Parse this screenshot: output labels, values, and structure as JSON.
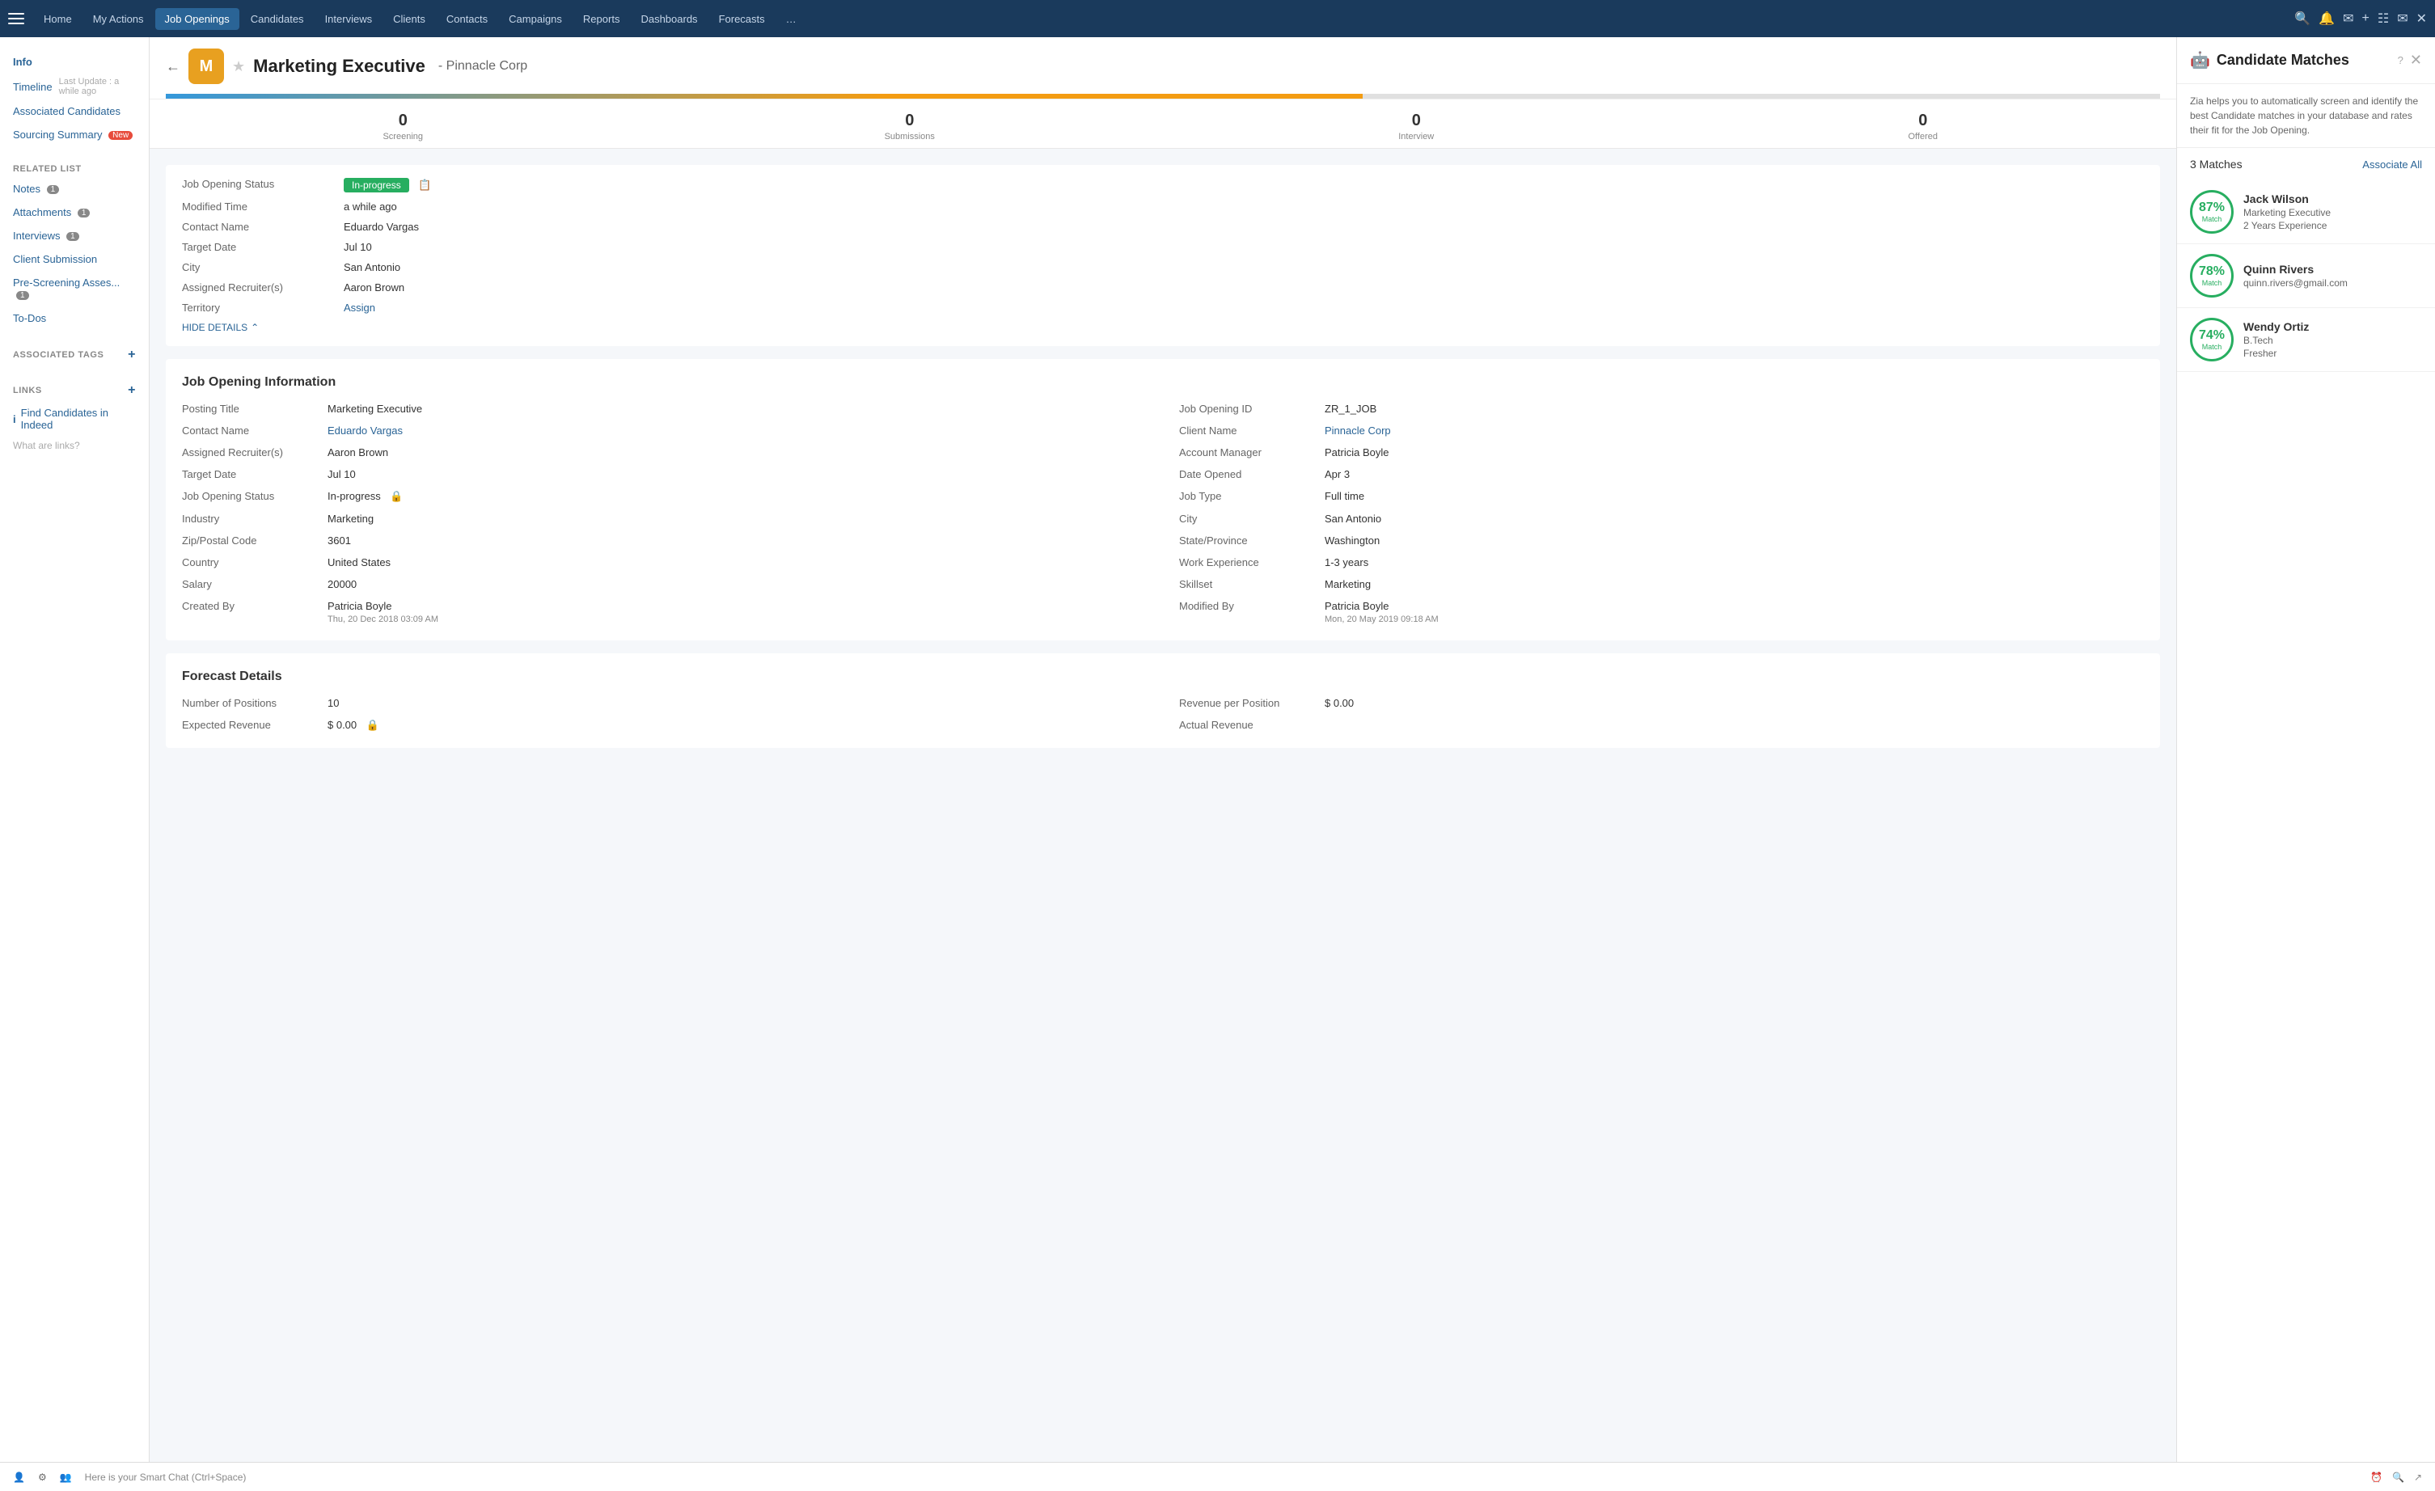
{
  "nav": {
    "items": [
      {
        "label": "Home",
        "active": false
      },
      {
        "label": "My Actions",
        "active": false
      },
      {
        "label": "Job Openings",
        "active": true
      },
      {
        "label": "Candidates",
        "active": false
      },
      {
        "label": "Interviews",
        "active": false
      },
      {
        "label": "Clients",
        "active": false
      },
      {
        "label": "Contacts",
        "active": false
      },
      {
        "label": "Campaigns",
        "active": false
      },
      {
        "label": "Reports",
        "active": false
      },
      {
        "label": "Dashboards",
        "active": false
      },
      {
        "label": "Forecasts",
        "active": false
      },
      {
        "label": "...",
        "active": false
      }
    ]
  },
  "sidebar": {
    "info_label": "Info",
    "timeline_label": "Timeline",
    "timeline_update": "Last Update : a while ago",
    "associated_candidates_label": "Associated Candidates",
    "sourcing_summary_label": "Sourcing Summary",
    "sourcing_new": "New",
    "related_list_title": "RELATED LIST",
    "notes_label": "Notes",
    "notes_count": "1",
    "attachments_label": "Attachments",
    "attachments_count": "1",
    "interviews_label": "Interviews",
    "interviews_count": "1",
    "client_submission_label": "Client Submission",
    "pre_screening_label": "Pre-Screening Asses...",
    "pre_screening_count": "1",
    "todos_label": "To-Dos",
    "associated_tags_title": "ASSOCIATED TAGS",
    "links_title": "LINKS",
    "find_candidates_label": "Find Candidates in Indeed",
    "links_help": "What are links?"
  },
  "record": {
    "title": "Marketing Executive",
    "client": "- Pinnacle Corp",
    "avatar_letter": "M",
    "stages": [
      {
        "count": "0",
        "label": "Screening"
      },
      {
        "count": "0",
        "label": "Submissions"
      },
      {
        "count": "0",
        "label": "Interview"
      },
      {
        "count": "0",
        "label": "Offered"
      }
    ],
    "quick_info": {
      "status_label": "Job Opening Status",
      "status_value": "In-progress",
      "modified_label": "Modified Time",
      "modified_value": "a while ago",
      "contact_label": "Contact Name",
      "contact_value": "Eduardo Vargas",
      "target_date_label": "Target Date",
      "target_date_value": "Jul 10",
      "city_label": "City",
      "city_value": "San Antonio",
      "recruiter_label": "Assigned Recruiter(s)",
      "recruiter_value": "Aaron Brown",
      "territory_label": "Territory",
      "territory_value": "Assign",
      "hide_details": "HIDE DETAILS"
    },
    "job_info": {
      "section_title": "Job Opening Information",
      "fields": [
        {
          "label": "Posting Title",
          "value": "Marketing Executive",
          "link": false
        },
        {
          "label": "Job Opening ID",
          "value": "ZR_1_JOB",
          "link": false
        },
        {
          "label": "Contact Name",
          "value": "Eduardo Vargas",
          "link": true
        },
        {
          "label": "Client Name",
          "value": "Pinnacle Corp",
          "link": true
        },
        {
          "label": "Assigned Recruiter(s)",
          "value": "Aaron Brown",
          "link": false
        },
        {
          "label": "Account Manager",
          "value": "Patricia Boyle",
          "link": false
        },
        {
          "label": "Target Date",
          "value": "Jul 10",
          "link": false
        },
        {
          "label": "Date Opened",
          "value": "Apr 3",
          "link": false
        },
        {
          "label": "Job Opening Status",
          "value": "In-progress",
          "link": false
        },
        {
          "label": "Job Type",
          "value": "Full time",
          "link": false
        },
        {
          "label": "Industry",
          "value": "Marketing",
          "link": false
        },
        {
          "label": "City",
          "value": "San Antonio",
          "link": false
        },
        {
          "label": "Zip/Postal Code",
          "value": "3601",
          "link": false
        },
        {
          "label": "State/Province",
          "value": "Washington",
          "link": false
        },
        {
          "label": "Country",
          "value": "United States",
          "link": false
        },
        {
          "label": "Work Experience",
          "value": "1-3 years",
          "link": false
        },
        {
          "label": "Salary",
          "value": "20000",
          "link": false
        },
        {
          "label": "Skillset",
          "value": "Marketing",
          "link": false
        },
        {
          "label": "Created By",
          "value": "Patricia Boyle",
          "value2": "Thu, 20 Dec 2018 03:09 AM",
          "link": false
        },
        {
          "label": "Modified By",
          "value": "Patricia Boyle",
          "value2": "Mon, 20 May 2019 09:18 AM",
          "link": false
        }
      ]
    },
    "forecast": {
      "section_title": "Forecast Details",
      "fields": [
        {
          "label": "Number of Positions",
          "value": "10",
          "link": false
        },
        {
          "label": "Revenue per Position",
          "value": "$ 0.00",
          "link": false
        },
        {
          "label": "Expected Revenue",
          "value": "$ 0.00",
          "link": false
        },
        {
          "label": "Actual Revenue",
          "value": "",
          "link": false
        }
      ]
    }
  },
  "candidate_matches": {
    "panel_title": "Candidate Matches",
    "description": "Zia helps you to automatically screen and identify the best Candidate matches in your database and rates their fit for the Job Opening.",
    "matches_count": "3 Matches",
    "associate_all": "Associate All",
    "candidates": [
      {
        "percent": "87%",
        "label": "Match",
        "name": "Jack Wilson",
        "detail1": "Marketing Executive",
        "detail2": "2 Years Experience"
      },
      {
        "percent": "78%",
        "label": "Match",
        "name": "Quinn Rivers",
        "detail1": "quinn.rivers@gmail.com",
        "detail2": ""
      },
      {
        "percent": "74%",
        "label": "Match",
        "name": "Wendy Ortiz",
        "detail1": "B.Tech",
        "detail2": "Fresher"
      }
    ]
  },
  "bottom": {
    "smart_chat": "Here is your Smart Chat (Ctrl+Space)"
  }
}
